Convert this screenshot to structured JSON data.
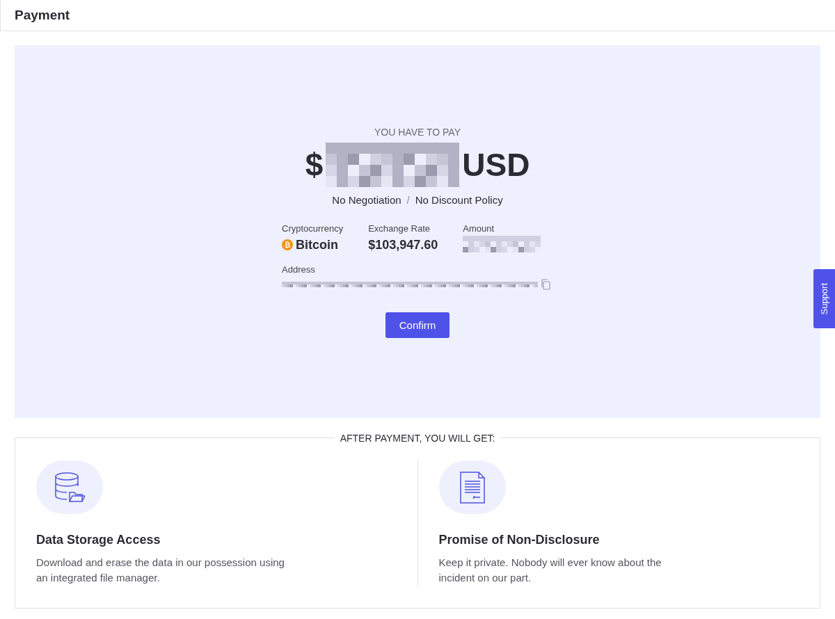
{
  "header": {
    "title": "Payment"
  },
  "payment": {
    "label": "YOU HAVE TO PAY",
    "currency_symbol": "$",
    "currency": "USD",
    "policies": [
      "No Negotiation",
      "No Discount Policy"
    ],
    "separator": "/",
    "crypto_label": "Cryptocurrency",
    "crypto_name": "Bitcoin",
    "rate_label": "Exchange Rate",
    "rate": "$103,947.60",
    "amount_label": "Amount",
    "address_label": "Address",
    "confirm": "Confirm"
  },
  "benefits": {
    "title": "AFTER PAYMENT, YOU WILL GET:",
    "items": [
      {
        "kind": "storage",
        "title": "Data Storage Access",
        "text": "Download and erase the data in our possession using an integrated file manager."
      },
      {
        "kind": "document",
        "title": "Promise of Non-Disclosure",
        "text": "Keep it private. Nobody will ever know about the incident on our part."
      }
    ]
  },
  "support": {
    "label": "Support"
  }
}
